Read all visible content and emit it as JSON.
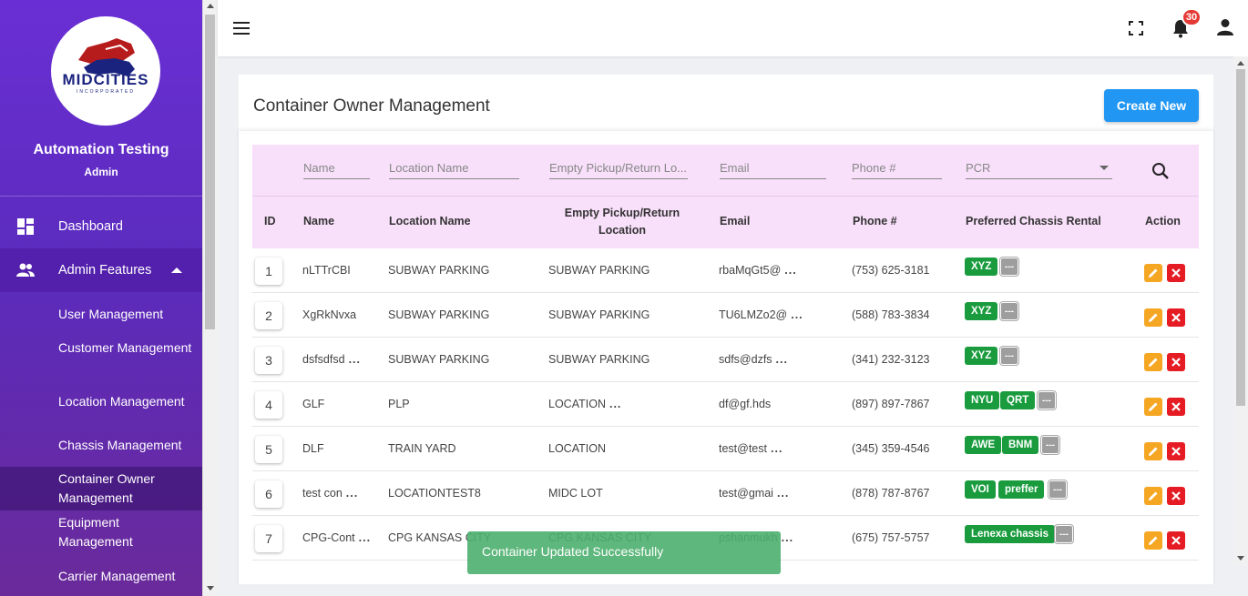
{
  "sidebar": {
    "logo_text": "MIDCITIES",
    "logo_sub": "INCORPORATED",
    "user_name": "Automation Testing",
    "user_role": "Admin",
    "nav": [
      {
        "label": "Dashboard",
        "icon": "dashboard-icon"
      },
      {
        "label": "Admin Features",
        "icon": "people-icon",
        "expanded": true
      }
    ],
    "sub_items": [
      "User Management",
      "Customer Management",
      "Location Management",
      "Chassis Management",
      "Container Owner Management",
      "Equipment Management",
      "Carrier Management"
    ],
    "active_sub": "Container Owner Management"
  },
  "topbar": {
    "menu_icon": "hamburger-icon",
    "fullscreen_icon": "fullscreen-icon",
    "notification_icon": "bell-icon",
    "notification_count": "30",
    "account_icon": "person-icon"
  },
  "page": {
    "title": "Container Owner Management",
    "create_label": "Create New"
  },
  "filters": {
    "name": "Name",
    "location": "Location Name",
    "empty_pickup": "Empty Pickup/Return Lo...",
    "email": "Email",
    "phone": "Phone #",
    "pcr": "PCR"
  },
  "columns": {
    "id": "ID",
    "name": "Name",
    "location": "Location Name",
    "empty_pickup_1": "Empty Pickup/Return",
    "empty_pickup_2": "Location",
    "email": "Email",
    "phone": "Phone #",
    "chassis": "Preferred Chassis Rental",
    "action": "Action"
  },
  "rows": [
    {
      "id": "1",
      "name": "nLTTrCBI",
      "name_more": "",
      "location": "SUBWAY PARKING",
      "empty": "SUBWAY PARKING",
      "empty_more": "",
      "email": "rbaMqGt5@",
      "email_more": "...",
      "phone": "(753) 625-3181",
      "tags": [
        "XYZ"
      ],
      "more": "---"
    },
    {
      "id": "2",
      "name": "XgRkNvxa",
      "name_more": "",
      "location": "SUBWAY PARKING",
      "empty": "SUBWAY PARKING",
      "empty_more": "",
      "email": "TU6LMZo2@",
      "email_more": "...",
      "phone": "(588) 783-3834",
      "tags": [
        "XYZ"
      ],
      "more": "---"
    },
    {
      "id": "3",
      "name": "dsfsdfsd",
      "name_more": "...",
      "location": "SUBWAY PARKING",
      "empty": "SUBWAY PARKING",
      "empty_more": "",
      "email": "sdfs@dzfs",
      "email_more": "...",
      "phone": "(341) 232-3123",
      "tags": [
        "XYZ"
      ],
      "more": "---"
    },
    {
      "id": "4",
      "name": "GLF",
      "name_more": "",
      "location": "PLP",
      "empty": "LOCATION",
      "empty_more": "...",
      "email": "df@gf.hds",
      "email_more": "",
      "phone": "(897) 897-7867",
      "tags": [
        "NYU",
        "QRT"
      ],
      "more": "---"
    },
    {
      "id": "5",
      "name": "DLF",
      "name_more": "",
      "location": "TRAIN YARD",
      "empty": "LOCATION",
      "empty_more": "",
      "email": "test@test",
      "email_more": "...",
      "phone": "(345) 359-4546",
      "tags": [
        "AWE",
        "BNM"
      ],
      "more": "---"
    },
    {
      "id": "6",
      "name": "test con",
      "name_more": "...",
      "location": "LOCATIONTEST8",
      "empty": "MIDC LOT",
      "empty_more": "",
      "email": "test@gmai",
      "email_more": "...",
      "phone": "(878) 787-8767",
      "tags": [
        "VOI",
        "preffer"
      ],
      "more": "---"
    },
    {
      "id": "7",
      "name": "CPG-Cont",
      "name_more": "...",
      "location": "CPG KANSAS CITY",
      "empty": "CPG KANSAS CITY",
      "empty_more": "",
      "email": "pshanmukh",
      "email_more": "...",
      "phone": "(675) 757-5757",
      "tags": [
        "Lenexa chassis"
      ],
      "more": "---"
    }
  ],
  "toast": "Container Updated Successfully",
  "colors": {
    "sidebar_top": "#6a2fd4",
    "primary_button": "#2196f3",
    "tag_green": "#1a9c3e",
    "edit_orange": "#f5a623",
    "delete_red": "#e51c23",
    "header_pink": "#f8dffa"
  }
}
